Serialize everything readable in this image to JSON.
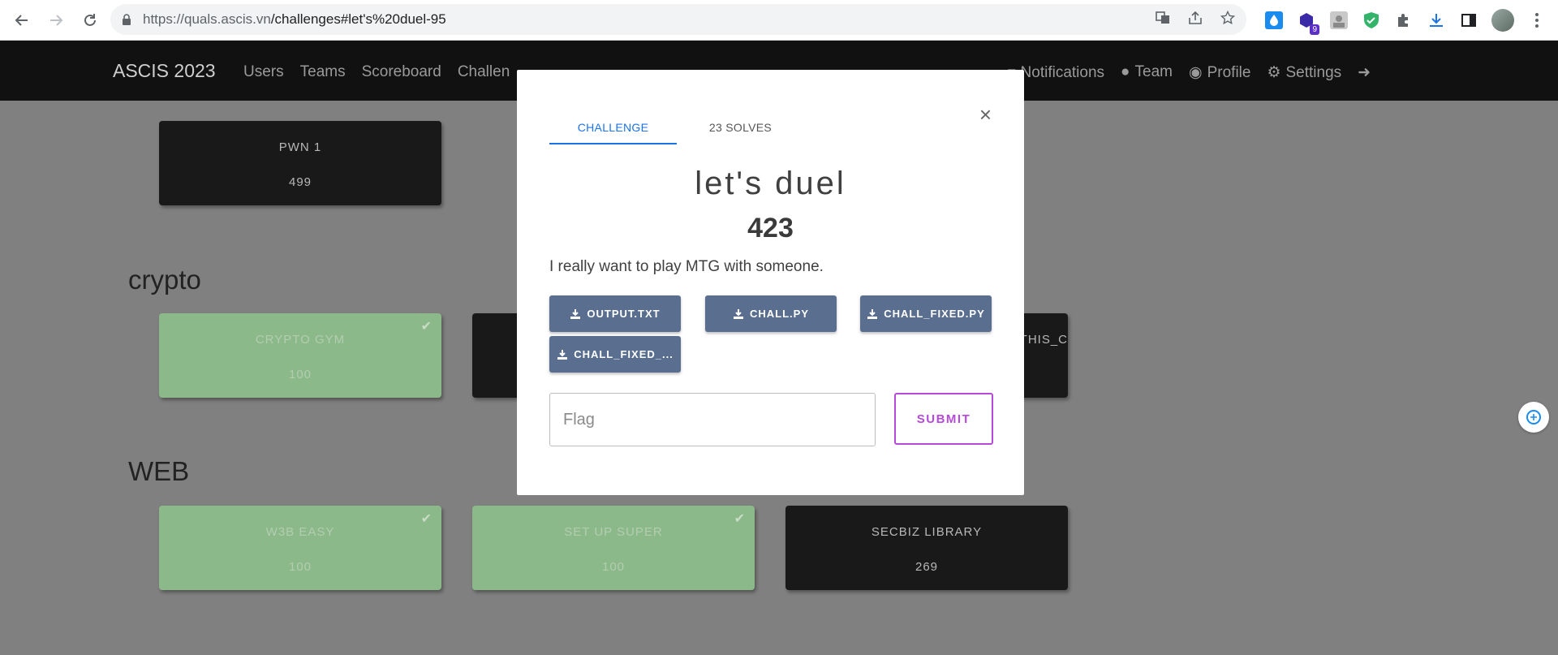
{
  "browser": {
    "url_host": "https://quals.ascis.vn",
    "url_path": "/challenges#let's%20duel-95",
    "extension_badge": "9"
  },
  "navbar": {
    "brand": "ASCIS 2023",
    "left": [
      "Users",
      "Teams",
      "Scoreboard",
      "Challen"
    ],
    "right": [
      "Notifications",
      "Team",
      "Profile",
      "Settings"
    ]
  },
  "page": {
    "categories": [
      {
        "title": "crypto"
      },
      {
        "title": "WEB"
      }
    ],
    "cards": [
      {
        "name": "PWN 1",
        "points": "499",
        "solved": false
      },
      {
        "name": "CRYPTO GYM",
        "points": "100",
        "solved": true
      },
      {
        "name": "THIS_C",
        "points": "",
        "solved": false
      },
      {
        "name": "W3B EASY",
        "points": "100",
        "solved": true
      },
      {
        "name": "SET UP SUPER",
        "points": "100",
        "solved": true
      },
      {
        "name": "SECBIZ LIBRARY",
        "points": "269",
        "solved": false
      }
    ]
  },
  "modal": {
    "tab_challenge": "CHALLENGE",
    "tab_solves": "23 SOLVES",
    "close": "×",
    "title": "let's duel",
    "points": "423",
    "description": "I really want to play MTG with someone.",
    "files": [
      "OUTPUT.TXT",
      "CHALL.PY",
      "CHALL_FIXED.PY",
      "CHALL_FIXED_..."
    ],
    "flag_placeholder": "Flag",
    "submit": "SUBMIT"
  },
  "colors": {
    "accent_blue": "#1b73e8",
    "file_button": "#5a6f8f",
    "submit_purple": "#b64ad9",
    "solved_card": "#8cb98a",
    "unsolved_card": "#191919"
  }
}
